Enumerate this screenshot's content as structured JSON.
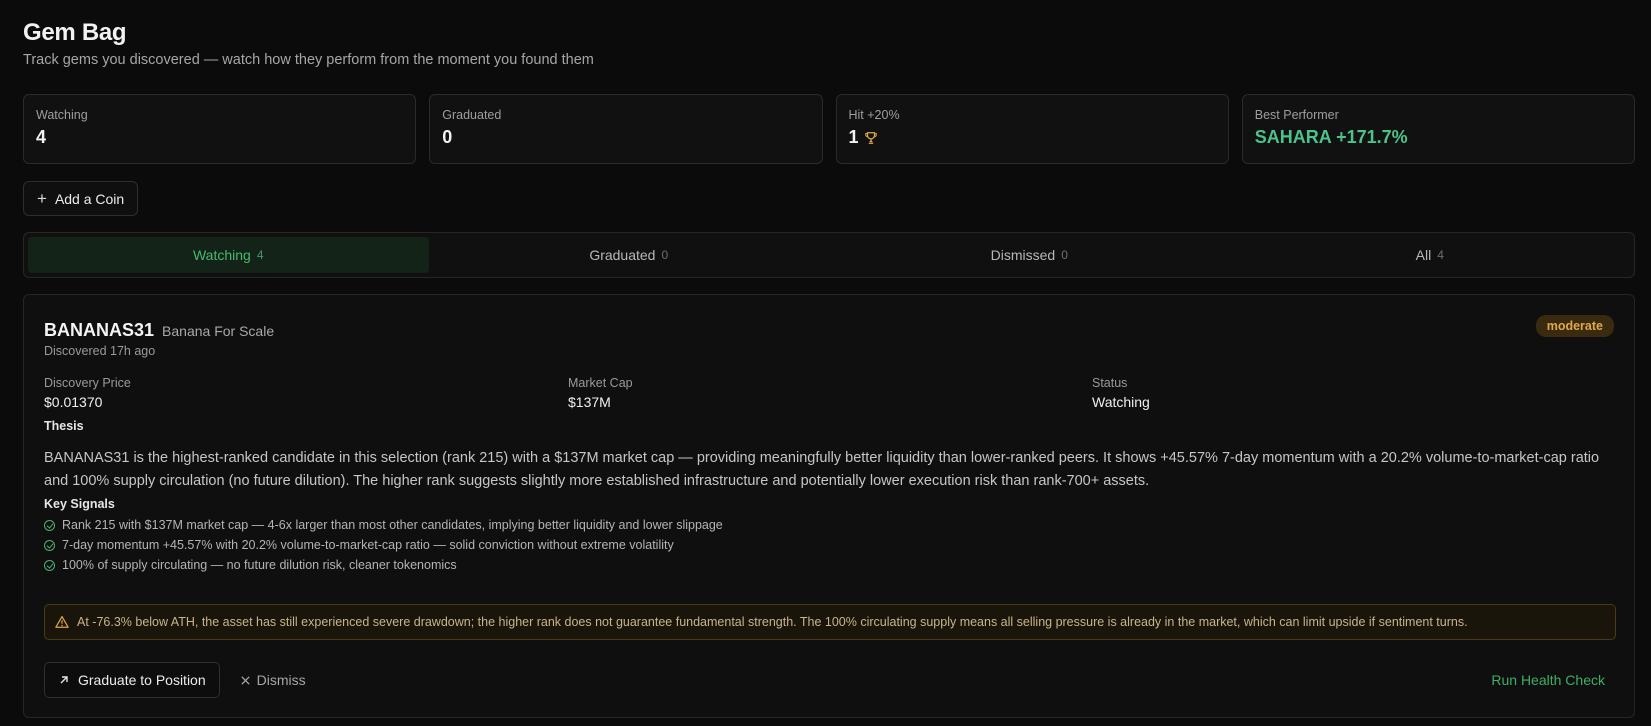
{
  "header": {
    "title": "Gem Bag",
    "subtitle": "Track gems you discovered — watch how they perform from the moment you found them"
  },
  "stats": [
    {
      "label": "Watching",
      "value": "4"
    },
    {
      "label": "Graduated",
      "value": "0"
    },
    {
      "label": "Hit +20%",
      "value": "1",
      "icon": "trophy-icon"
    },
    {
      "label": "Best Performer",
      "value": "SAHARA +171.7%",
      "color": "#4cc38a"
    }
  ],
  "add_button": {
    "label": "Add a Coin"
  },
  "tabs": [
    {
      "label": "Watching",
      "count": "4",
      "active": true
    },
    {
      "label": "Graduated",
      "count": "0"
    },
    {
      "label": "Dismissed",
      "count": "0"
    },
    {
      "label": "All",
      "count": "4"
    }
  ],
  "gem": {
    "symbol": "BANANAS31",
    "name": "Banana For Scale",
    "discovered": "Discovered 17h ago",
    "risk_badge": "moderate",
    "metrics": [
      {
        "label": "Discovery Price",
        "value": "$0.01370"
      },
      {
        "label": "Market Cap",
        "value": "$137M"
      },
      {
        "label": "Status",
        "value": "Watching"
      }
    ],
    "thesis_title": "Thesis",
    "thesis": "BANANAS31 is the highest-ranked candidate in this selection (rank 215) with a $137M market cap — providing meaningfully better liquidity than lower-ranked peers. It shows +45.57% 7-day momentum with a 20.2% volume-to-market-cap ratio and 100% supply circulation (no future dilution). The higher rank suggests slightly more established infrastructure and potentially lower execution risk than rank-700+ assets.",
    "signals_title": "Key Signals",
    "signals": [
      "Rank 215 with $137M market cap — 4-6x larger than most other candidates, implying better liquidity and lower slippage",
      "7-day momentum +45.57% with 20.2% volume-to-market-cap ratio — solid conviction without extreme volatility",
      "100% of supply circulating — no future dilution risk, cleaner tokenomics"
    ],
    "warning": "At -76.3% below ATH, the asset has still experienced severe drawdown; the higher rank does not guarantee fundamental strength. The 100% circulating supply means all selling pressure is already in the market, which can limit upside if sentiment turns.",
    "actions": {
      "graduate": "Graduate to Position",
      "dismiss": "Dismiss",
      "health_check": "Run Health Check"
    }
  },
  "colors": {
    "accent_green": "#4cc38a",
    "warning_amber": "#e0a94a",
    "background": "#0b0b0b"
  }
}
